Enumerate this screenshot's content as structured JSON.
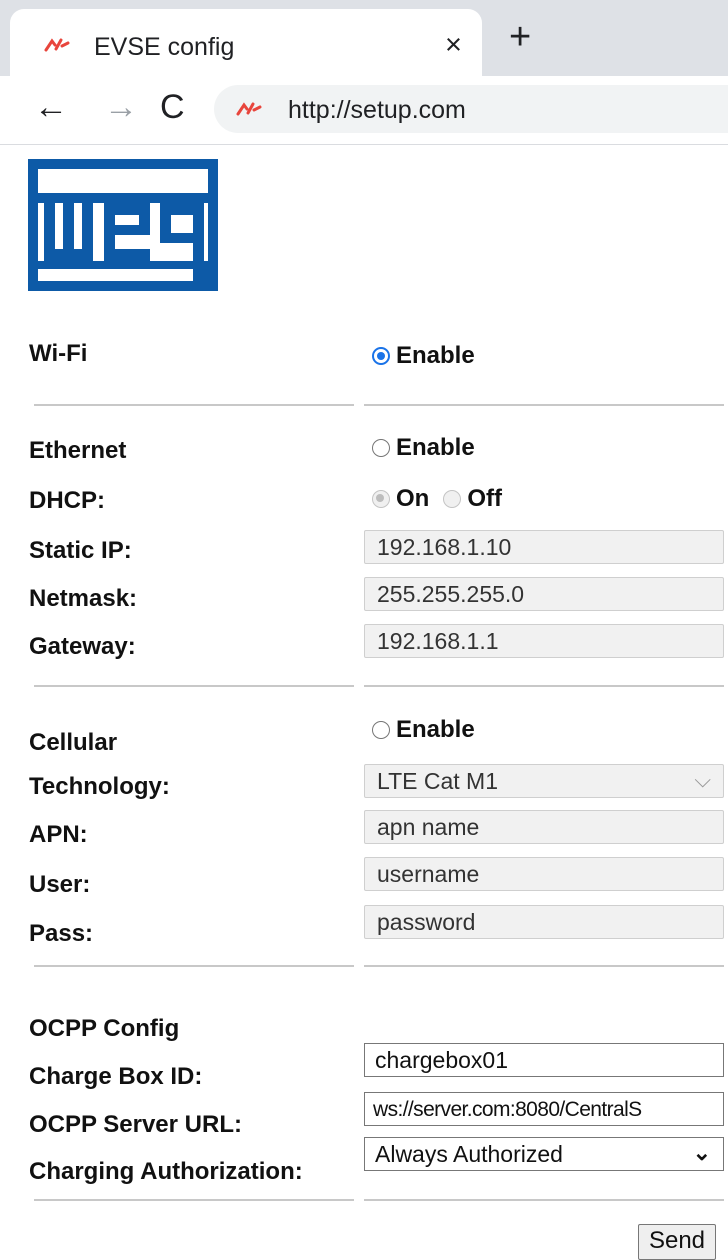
{
  "browser": {
    "tab_title": "EVSE config",
    "tab_close": "×",
    "new_tab": "+",
    "url": "http://setup.com",
    "nav_back": "←",
    "nav_forward": "→",
    "nav_reload": "C"
  },
  "logo": {
    "alt": "weg",
    "color": "#0d5aa7"
  },
  "wifi": {
    "label": "Wi-Fi",
    "enable_label": "Enable",
    "enabled": true
  },
  "ethernet": {
    "label": "Ethernet",
    "enable_label": "Enable",
    "enabled": false,
    "dhcp_label": "DHCP:",
    "dhcp_on_label": "On",
    "dhcp_off_label": "Off",
    "dhcp_value": "On",
    "static_ip_label": "Static IP:",
    "static_ip": "192.168.1.10",
    "netmask_label": "Netmask:",
    "netmask": "255.255.255.0",
    "gateway_label": "Gateway:",
    "gateway": "192.168.1.1"
  },
  "cellular": {
    "label": "Cellular",
    "enable_label": "Enable",
    "enabled": false,
    "technology_label": "Technology:",
    "technology": "LTE Cat M1",
    "apn_label": "APN:",
    "apn": "apn name",
    "user_label": "User:",
    "user": "username",
    "pass_label": "Pass:",
    "pass": "password"
  },
  "ocpp": {
    "label": "OCPP Config",
    "charge_box_id_label": "Charge Box ID:",
    "charge_box_id": "chargebox01",
    "server_url_label": "OCPP Server URL:",
    "server_url": "ws://server.com:8080/CentralS",
    "auth_label": "Charging Authorization:",
    "auth": "Always Authorized"
  },
  "send_label": "Send",
  "colors": {
    "accent": "#1a73e8",
    "chrome_bg": "#dee1e6",
    "favicon": "#e8453c"
  }
}
